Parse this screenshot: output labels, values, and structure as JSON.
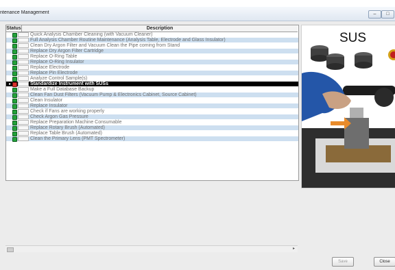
{
  "window": {
    "title": "ntenance Management"
  },
  "grid": {
    "col_status": "Status",
    "col_description": "Description",
    "rows": [
      {
        "label": "Quick Analysis Chamber Cleaning (with Vacuum Cleaner)"
      },
      {
        "label": "Full Analysis Chamber Routine Maintenance (Analysis Table, Electrode and Glass Insulator)"
      },
      {
        "label": "Clean Dry Argon Filter and Vacuum Clean the Pipe coming from Stand"
      },
      {
        "label": "Replace Dry Argon Filter Cartridge"
      },
      {
        "label": "Replace O-Ring Table"
      },
      {
        "label": "Replace O-Ring Insulator"
      },
      {
        "label": "Replace Electrode"
      },
      {
        "label": "Replace Pin Electrode"
      },
      {
        "label": "Analyze Control Sample(s)"
      },
      {
        "label": "Standardize Instrument with SUSs"
      },
      {
        "label": "Make a Full Database Backup"
      },
      {
        "label": "Clean Fan Dust Filters (Vacuum Pump & Electronics Cabinet, Source Cabinet)"
      },
      {
        "label": "Clean Insulator"
      },
      {
        "label": "Replace Insulator"
      },
      {
        "label": "Check if Fans are working properly"
      },
      {
        "label": "Check Argon Gas Pressure"
      },
      {
        "label": "Replace Preparation Machine Consumable"
      },
      {
        "label": "Replace Rotary Brush (Automated)"
      },
      {
        "label": "Replace Table Brush (Automated)"
      },
      {
        "label": "Clean the Primary Lens (PMT Spectrometer)"
      }
    ],
    "selected_index": 9
  },
  "image_panel": {
    "label": "SUS"
  },
  "buttons": {
    "save": "Save",
    "close": "Close"
  },
  "colors": {
    "status_ok": "#23a23a",
    "status_due": "#d9322b",
    "row_alt": "#cddff0",
    "row_selected": "#000000"
  },
  "icons": {
    "status_ok": "green-status-icon",
    "status_due": "red-status-icon",
    "minimize": "minimize-icon",
    "maximize": "maximize-icon"
  }
}
